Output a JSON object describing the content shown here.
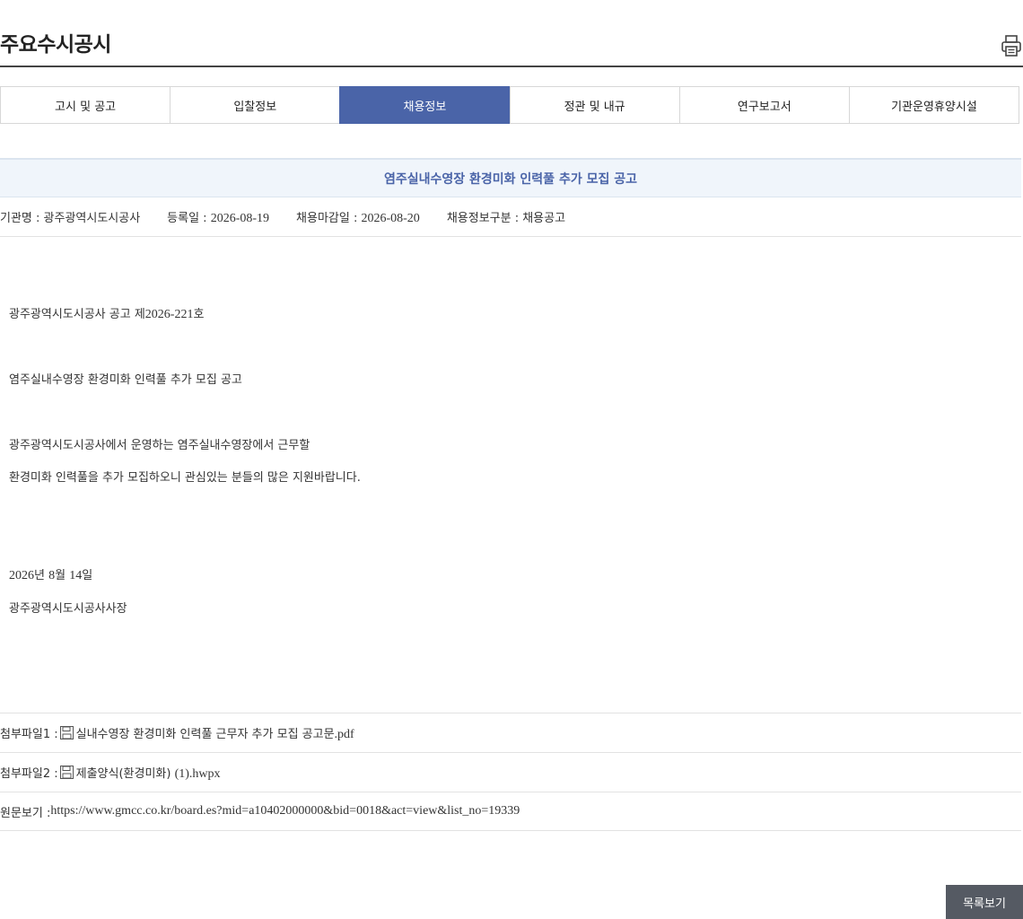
{
  "page": {
    "title": "주요수시공시",
    "print_icon": "printer-icon"
  },
  "tabs": [
    {
      "label": "고시 및 공고",
      "active": false
    },
    {
      "label": "입찰정보",
      "active": false
    },
    {
      "label": "채용정보",
      "active": true
    },
    {
      "label": "정관 및 내규",
      "active": false
    },
    {
      "label": "연구보고서",
      "active": false
    },
    {
      "label": "기관운영휴양시설",
      "active": false
    }
  ],
  "notice": {
    "title": "염주실내수영장 환경미화 인력풀 추가 모집 공고",
    "meta": {
      "org_label": "기관명 : ",
      "org_value": "광주광역시도시공사",
      "reg_label": "등록일 : ",
      "reg_value": "2026-08-19",
      "deadline_label": "채용마감일 : ",
      "deadline_value": "2026-08-20",
      "type_label": "채용정보구분 : ",
      "type_value": "채용공고"
    },
    "body": {
      "line1_prefix": "광주광역시도시공사 공고 제",
      "line1_number": "2026-221",
      "line1_suffix": "호",
      "line2": "염주실내수영장 환경미화 인력풀 추가 모집 공고",
      "line3": "광주광역시도시공사에서 운영하는 염주실내수영장에서 근무할",
      "line4": "환경미화 인력풀을 추가 모집하오니 관심있는 분들의 많은 지원바랍니다.",
      "date_year": "2026",
      "date_year_unit": "년 ",
      "date_month": "8",
      "date_month_unit": "월 ",
      "date_day": "14",
      "date_day_unit": "일",
      "signature": "광주광역시도시공사사장"
    }
  },
  "attachments": [
    {
      "label": "첨부파일1 : ",
      "file_name": "실내수영장 환경미화 인력풀 근무자 추가 모집 공고문",
      "ext": ".pdf",
      "icon": "floppy-disk-icon"
    },
    {
      "label": "첨부파일2 : ",
      "file_name": "제출양식(환경미화) ",
      "ext": "(1).hwpx",
      "icon": "floppy-disk-icon"
    }
  ],
  "source": {
    "label": "원문보기 : ",
    "url": "https://www.gmcc.co.kr/board.es?mid=a10402000000&bid=0018&act=view&list_no=19339"
  },
  "actions": {
    "list_button": "목록보기"
  },
  "colors": {
    "accent": "#4a64a8",
    "title_bg": "#f0f5fb",
    "button_bg": "#555a63"
  }
}
